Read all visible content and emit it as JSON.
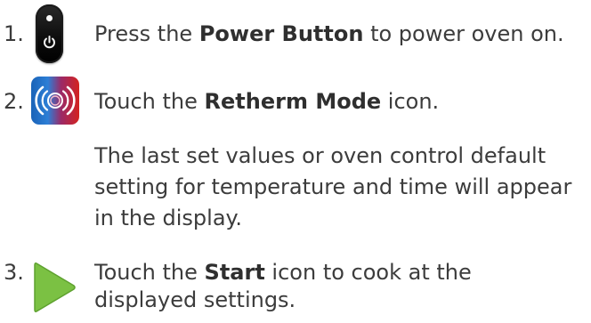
{
  "steps": [
    {
      "number": "1.",
      "icon": "power-button-icon",
      "text_before": "Press the ",
      "bold": "Power Button",
      "text_after": " to power oven on."
    },
    {
      "number": "2.",
      "icon": "retherm-mode-icon",
      "text_before": "Touch the ",
      "bold": "Retherm Mode",
      "text_after": " icon.",
      "note_lines": [
        "The last set values or oven control default",
        "setting for temperature and time will appear",
        "in the display."
      ]
    },
    {
      "number": "3.",
      "icon": "start-icon",
      "text_before": "Touch the ",
      "bold": "Start",
      "text_after": " icon to cook at the",
      "continuation": "displayed settings."
    }
  ],
  "colors": {
    "text": "#3c3c3c",
    "start_green": "#7bc143",
    "retherm_blue": "#1a63b8",
    "retherm_red": "#d4231f"
  }
}
